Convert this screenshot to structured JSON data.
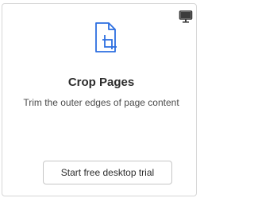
{
  "card": {
    "icons": {
      "badge": "desktop-monitor-icon",
      "tool": "crop-pages-icon"
    },
    "title": "Crop Pages",
    "description": "Trim the outer edges of page content",
    "cta_label": "Start free desktop trial"
  },
  "colors": {
    "accent": "#2d6fe0",
    "text": "#2c2c2c",
    "muted_text": "#4b4b4b",
    "border": "#d6d6d6"
  }
}
